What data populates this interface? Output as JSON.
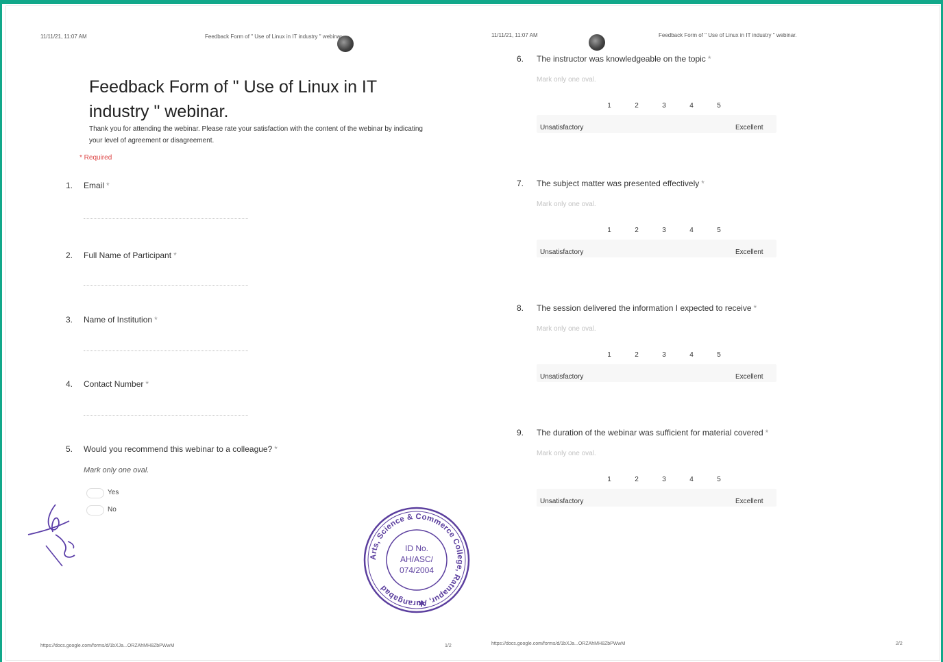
{
  "page_left": {
    "header_datetime": "11/11/21, 11:07 AM",
    "header_title": "Feedback Form of \" Use of Linux in IT industry \" webinar.",
    "form_title_line1": "Feedback Form of \" Use of Linux in IT",
    "form_title_line2": "industry \" webinar.",
    "description": "Thank you for attending the webinar. Please rate your satisfaction with the content of the webinar by indicating your level of agreement or disagreement.",
    "required_note": "* Required",
    "questions": [
      {
        "num": "1.",
        "text": "Email",
        "required": "*"
      },
      {
        "num": "2.",
        "text": "Full Name of Participant",
        "required": "*"
      },
      {
        "num": "3.",
        "text": "Name of Institution",
        "required": "*"
      },
      {
        "num": "4.",
        "text": "Contact Number",
        "required": "*"
      },
      {
        "num": "5.",
        "text": "Would you recommend this webinar to a colleague?",
        "required": "*"
      }
    ],
    "q5_hint": "Mark only one oval.",
    "q5_options": [
      "Yes",
      "No"
    ],
    "footer_url": "https://docs.google.com/forms/d/1bXJa...ORZAhMH8ZbPWwM",
    "footer_page": "1/2"
  },
  "page_right": {
    "header_datetime": "11/11/21, 11:07 AM",
    "header_title": "Feedback Form of \" Use of Linux in IT industry \" webinar.",
    "questions": [
      {
        "num": "6.",
        "text": "The instructor was knowledgeable on the topic",
        "required": "*"
      },
      {
        "num": "7.",
        "text": "The subject matter was presented effectively",
        "required": "*"
      },
      {
        "num": "8.",
        "text": "The session delivered the information I expected to receive",
        "required": "*"
      },
      {
        "num": "9.",
        "text": "The duration of the webinar was sufficient for material covered",
        "required": "*"
      }
    ],
    "hint": "Mark only one oval.",
    "scale": [
      "1",
      "2",
      "3",
      "4",
      "5"
    ],
    "low_label": "Unsatisfactory",
    "high_label": "Excellent",
    "footer_url": "https://docs.google.com/forms/d/1bXJa...ORZAhMH8ZbPWwM",
    "footer_page": "2/2"
  },
  "stamp": {
    "top_text": "Arts, Science & Commerce College, Ratnapur, Aurangabad",
    "center_line1": "ID No.",
    "center_line2": "AH/ASC/",
    "center_line3": "074/2004",
    "color": "#5b3e9e"
  },
  "accent_color": "#11a88a"
}
